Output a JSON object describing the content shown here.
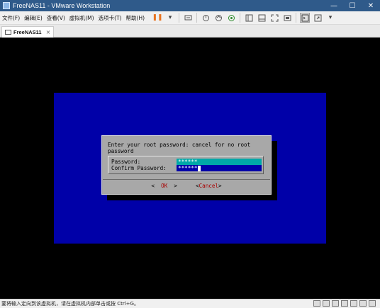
{
  "window": {
    "title": "FreeNAS11 - VMware Workstation",
    "minimize_glyph": "—",
    "maximize_glyph": "☐",
    "close_glyph": "✕"
  },
  "menu": {
    "items": [
      "文件(F)",
      "编辑(E)",
      "查看(V)",
      "虚拟机(M)",
      "选项卡(T)",
      "帮助(H)"
    ]
  },
  "toolbar": {
    "icons": [
      "pause-icon",
      "dropdown-icon",
      "send-ctrl-alt-del-icon",
      "snapshot-icon",
      "revert-snapshot-icon",
      "snapshot-manager-icon",
      "sidebar-icon",
      "thumbnail-icon",
      "fullscreen-icon",
      "unity-icon",
      "console-icon",
      "stretch-icon"
    ],
    "pause_glyph": "❚❚",
    "dropdown_glyph": "▾"
  },
  "tab": {
    "label": "FreeNAS11",
    "close_glyph": "×"
  },
  "dialog": {
    "prompt": "Enter your root password: cancel for no root password",
    "password_label": "Password:",
    "password_value": "******",
    "confirm_label": "Confirm Password:",
    "confirm_value": "******",
    "ok_left": "<  ",
    "ok_label": "OK",
    "ok_right": "  >",
    "cancel_left": "<",
    "cancel_hot": "C",
    "cancel_rest": "ancel",
    "cancel_right": ">"
  },
  "colors": {
    "installer_blue": "#0000a8",
    "dialog_gray": "#a8a8a8",
    "active_field": "#00a8a8",
    "hotkey_red": "#a80000",
    "titlebar": "#2f5a8a"
  },
  "statusbar": {
    "text": "要将输入定向到该虚拟机，请在虚拟机内部单击或按 Ctrl+G。"
  }
}
